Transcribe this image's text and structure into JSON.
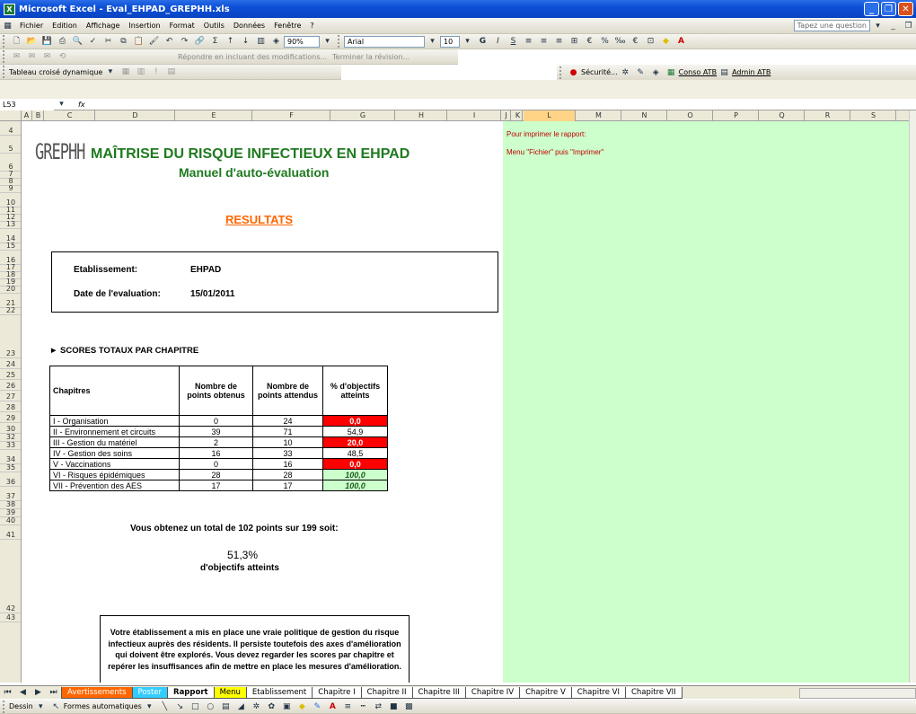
{
  "window": {
    "title": "Microsoft Excel - Eval_EHPAD_GREPHH.xls"
  },
  "menu": [
    "Fichier",
    "Edition",
    "Affichage",
    "Insertion",
    "Format",
    "Outils",
    "Données",
    "Fenêtre",
    "?"
  ],
  "help_placeholder": "Tapez une question",
  "toolbar": {
    "zoom": "90%",
    "font": "Arial",
    "size": "10",
    "review_text": "Répondre en incluant des modifications...",
    "review_end": "Terminer la révision...",
    "pivot": "Tableau croisé dynamique",
    "security": "Sécurité...",
    "conso": "Conso ATB",
    "admin": "Admin ATB"
  },
  "formula": {
    "cellref": "L53",
    "fx": "fx"
  },
  "columns": [
    "A",
    "B",
    "C",
    "D",
    "E",
    "F",
    "G",
    "H",
    "I",
    "J",
    "K",
    "L",
    "M",
    "N",
    "O",
    "P",
    "Q",
    "R",
    "S"
  ],
  "rows": [
    "4",
    "5",
    "6",
    "7",
    "8",
    "9",
    "10",
    "11",
    "12",
    "13",
    "14",
    "15",
    "16",
    "17",
    "18",
    "19",
    "20",
    "21",
    "22",
    "23",
    "24",
    "25",
    "26",
    "27",
    "28",
    "29",
    "30",
    "32",
    "33",
    "34",
    "35",
    "36",
    "37",
    "38",
    "39",
    "40",
    "41",
    "42",
    "43"
  ],
  "logo": "GREPHH",
  "header": {
    "title": "MAÎTRISE DU RISQUE INFECTIEUX EN EHPAD",
    "subtitle": "Manuel d'auto-évaluation"
  },
  "resultats": "RESULTATS",
  "info": {
    "etab_label": "Etablissement:",
    "etab_value": "EHPAD",
    "date_label": "Date de l'evaluation:",
    "date_value": "15/01/2011"
  },
  "section_title": "► SCORES TOTAUX PAR CHAPITRE",
  "table": {
    "headers": [
      "Chapitres",
      "Nombre de points obtenus",
      "Nombre de points attendus",
      "% d'objectifs atteints"
    ],
    "rows": [
      {
        "chap": "I - Organisation",
        "obt": "0",
        "att": "24",
        "pct": "0,0",
        "status": "red"
      },
      {
        "chap": "II - Environnement et circuits",
        "obt": "39",
        "att": "71",
        "pct": "54,9",
        "status": "normal"
      },
      {
        "chap": "III - Gestion du matériel",
        "obt": "2",
        "att": "10",
        "pct": "20,0",
        "status": "red"
      },
      {
        "chap": "IV - Gestion des soins",
        "obt": "16",
        "att": "33",
        "pct": "48,5",
        "status": "normal"
      },
      {
        "chap": "V - Vaccinations",
        "obt": "0",
        "att": "16",
        "pct": "0,0",
        "status": "red"
      },
      {
        "chap": "VI - Risques épidémiques",
        "obt": "28",
        "att": "28",
        "pct": "100,0",
        "status": "green"
      },
      {
        "chap": "VII - Prévention des AES",
        "obt": "17",
        "att": "17",
        "pct": "100,0",
        "status": "green"
      }
    ]
  },
  "total": {
    "line": "Vous obtenez un total de 102 points sur 199 soit:",
    "pct": "51,3%",
    "label": "d'objectifs atteints"
  },
  "note": "Votre établissement a mis en place une vraie politique de gestion du risque infectieux auprès des résidents. Il persiste toutefois des axes d'amélioration qui doivent être explorés. Vous devez regarder les scores par chapitre et repérer les insuffisances afin de mettre en place les mesures d'amélioration.",
  "print_hint": {
    "line1": "Pour imprimer le rapport:",
    "line2": "Menu \"Fichier\" puis \"Imprimer\""
  },
  "tabs": [
    {
      "label": "Avertissements",
      "bg": "#ff6600",
      "color": "#ffffff"
    },
    {
      "label": "Poster",
      "bg": "#33ccff",
      "color": "#ffffff"
    },
    {
      "label": "Rapport",
      "bg": "#ffffff",
      "color": "#000000",
      "active": true
    },
    {
      "label": "Menu",
      "bg": "#ffff00",
      "color": "#000000"
    },
    {
      "label": "Etablissement",
      "bg": "#ffffff",
      "color": "#000000"
    },
    {
      "label": "Chapitre I",
      "bg": "#ffffff",
      "color": "#000000"
    },
    {
      "label": "Chapitre II",
      "bg": "#ffffff",
      "color": "#000000"
    },
    {
      "label": "Chapitre III",
      "bg": "#ffffff",
      "color": "#000000"
    },
    {
      "label": "Chapitre IV",
      "bg": "#ffffff",
      "color": "#000000"
    },
    {
      "label": "Chapitre V",
      "bg": "#ffffff",
      "color": "#000000"
    },
    {
      "label": "Chapitre VI",
      "bg": "#ffffff",
      "color": "#000000"
    },
    {
      "label": "Chapitre VII",
      "bg": "#ffffff",
      "color": "#000000"
    }
  ],
  "drawbar": {
    "dessin": "Dessin",
    "formes": "Formes automatiques"
  }
}
